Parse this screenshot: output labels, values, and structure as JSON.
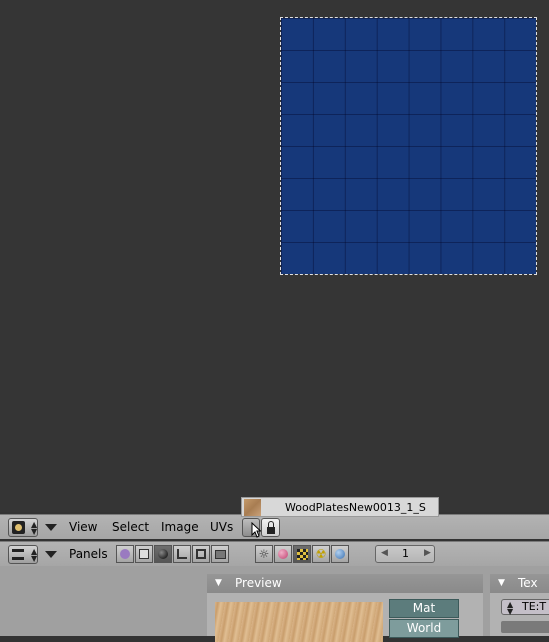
{
  "tooltip": {
    "image_name": "WoodPlatesNew0013_1_S"
  },
  "header1": {
    "menus": [
      "View",
      "Select",
      "Image",
      "UVs"
    ]
  },
  "header2": {
    "panels_label": "Panels",
    "frame_value": "1"
  },
  "preview_panel": {
    "title": "Preview",
    "tab_mat": "Mat",
    "tab_world": "World"
  },
  "texture_panel": {
    "title": "Tex",
    "browse_value": "TE:T"
  },
  "colors": {
    "uv_image_blue": "#16387a",
    "viewport_bg": "#353535",
    "header_bg": "#b3b3b3",
    "panel_tab_teal": "#5c7c7c"
  },
  "icons": [
    "editor-type-icon",
    "collapse-triangle-icon",
    "lock-icon",
    "panels-editor-icon",
    "logic-icon",
    "script-icon",
    "shading-icon",
    "object-icon",
    "editing-icon",
    "scene-icon",
    "lamp-icon",
    "material-icon",
    "texture-icon",
    "radiosity-icon",
    "world-icon"
  ]
}
